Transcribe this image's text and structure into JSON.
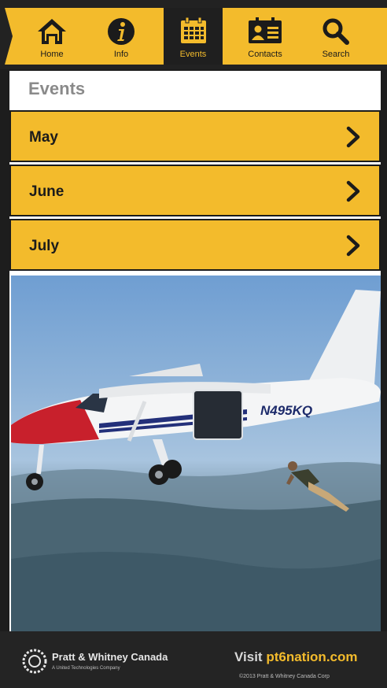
{
  "nav": {
    "items": [
      {
        "label": "Home",
        "icon": "home-icon"
      },
      {
        "label": "Info",
        "icon": "info-icon"
      },
      {
        "label": "Events",
        "icon": "calendar-icon",
        "active": true
      },
      {
        "label": "Contacts",
        "icon": "contact-card-icon"
      },
      {
        "label": "Search",
        "icon": "search-icon"
      }
    ]
  },
  "page": {
    "title": "Events",
    "months": [
      "May",
      "June",
      "July"
    ]
  },
  "photo": {
    "aircraft_registration": "N495KQ"
  },
  "footer": {
    "brand": "Pratt & Whitney Canada",
    "brand_sub": "A United Technologies Company",
    "visit_label": "Visit",
    "visit_site": "pt6nation.com",
    "copyright": "©2013 Pratt & Whitney Canada Corp"
  },
  "colors": {
    "accent": "#f3bb2c",
    "dark": "#1d1d1d",
    "title_gray": "#8a8a8a"
  }
}
